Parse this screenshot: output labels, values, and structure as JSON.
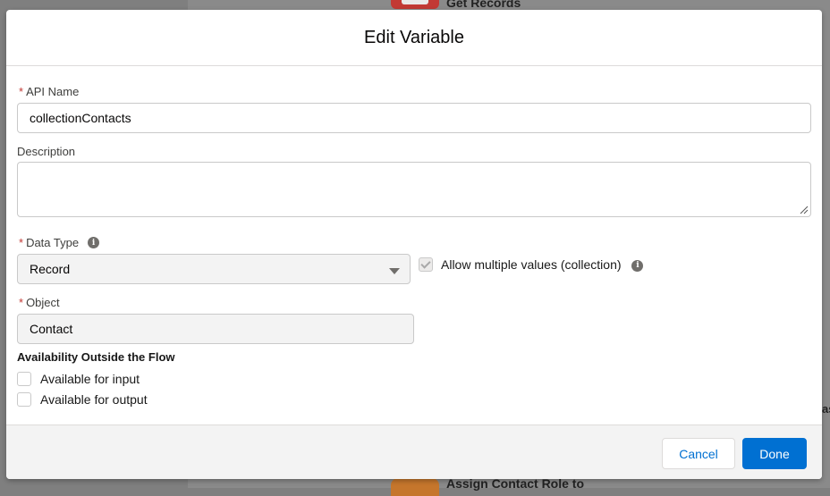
{
  "background": {
    "top_node_label": "Get Records",
    "bottom_node_label": "Assign Contact Role to",
    "side_text": "as"
  },
  "modal": {
    "title": "Edit Variable",
    "api_name": {
      "label": "API Name",
      "required_marker": "*",
      "value": "collectionContacts"
    },
    "description": {
      "label": "Description",
      "value": ""
    },
    "data_type": {
      "label": "Data Type",
      "required_marker": "*",
      "selected": "Record",
      "info_icon": "i"
    },
    "allow_multiple": {
      "label": "Allow multiple values (collection)",
      "checked": true,
      "disabled": true,
      "info_icon": "i"
    },
    "object": {
      "label": "Object",
      "required_marker": "*",
      "value": "Contact"
    },
    "availability": {
      "title": "Availability Outside the Flow",
      "input_label": "Available for input",
      "output_label": "Available for output",
      "input_checked": false,
      "output_checked": false
    },
    "footer": {
      "cancel_label": "Cancel",
      "done_label": "Done"
    }
  },
  "colors": {
    "brand": "#0070d2",
    "required": "#c23934",
    "overlay": "#7f7f7f"
  }
}
